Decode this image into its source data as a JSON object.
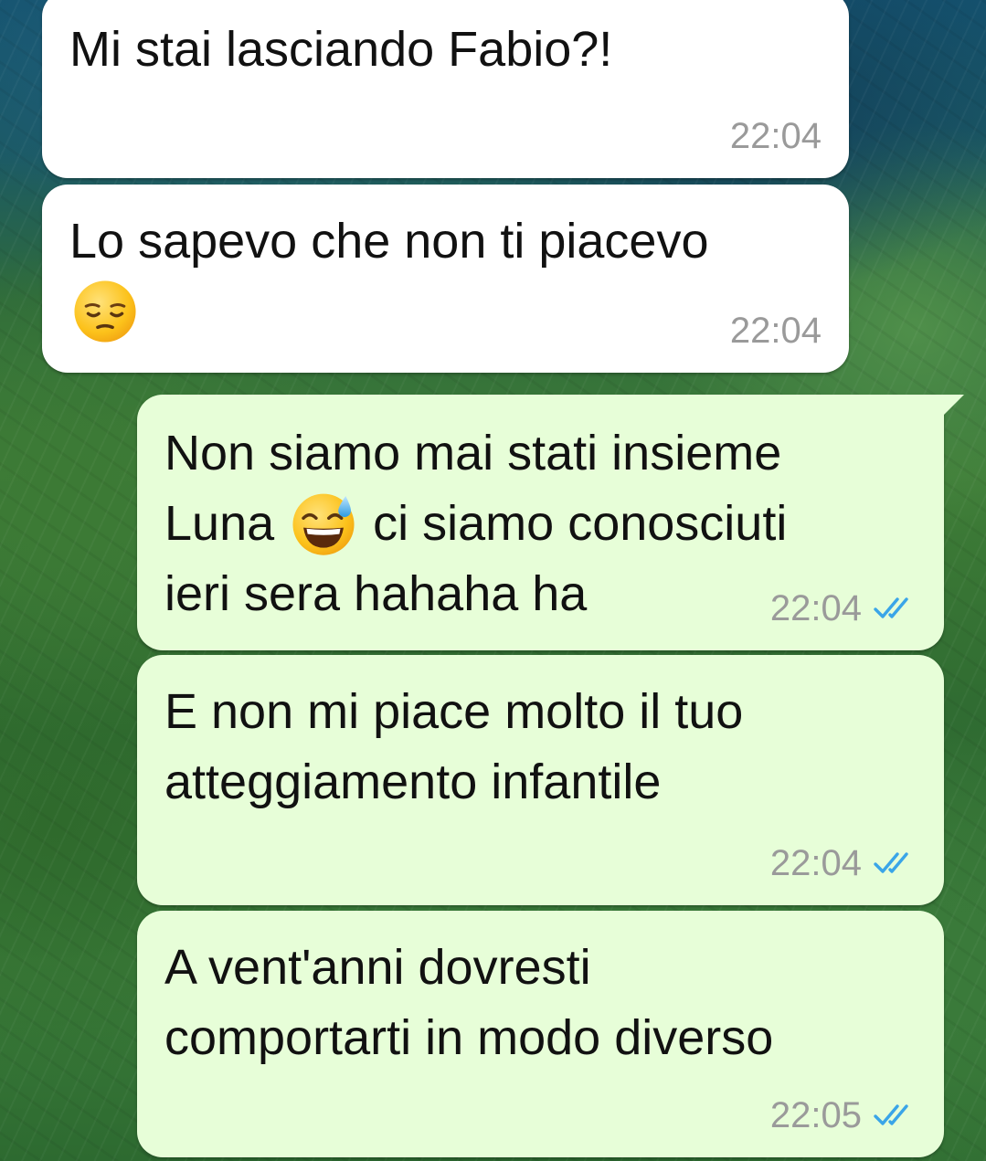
{
  "messages": [
    {
      "direction": "incoming",
      "text": "Mi stai lasciando Fabio?!",
      "time": "22:04"
    },
    {
      "direction": "incoming",
      "text": "Lo sapevo che non ti piacevo",
      "emoji": "pensive-face-emoji",
      "time": "22:04"
    },
    {
      "direction": "outgoing",
      "text_part1": "Non siamo mai stati insieme\nLuna ",
      "emoji": "grinning-face-with-sweat-emoji",
      "text_part2": " ci siamo conosciuti\nieri sera hahaha ha",
      "time": "22:04",
      "status": "read"
    },
    {
      "direction": "outgoing",
      "text": "E non mi piace molto il tuo\natteggiamento infantile",
      "time": "22:04",
      "status": "read"
    },
    {
      "direction": "outgoing",
      "text": "A vent'anni dovresti\ncomportarti in modo diverso",
      "time": "22:05",
      "status": "read"
    }
  ],
  "colors": {
    "incoming_bubble": "#ffffff",
    "outgoing_bubble": "#e7fed8",
    "timestamp": "#9a9a9a",
    "read_ticks": "#3aa5e8"
  },
  "icons": {
    "read_receipt": "double-check-icon"
  }
}
